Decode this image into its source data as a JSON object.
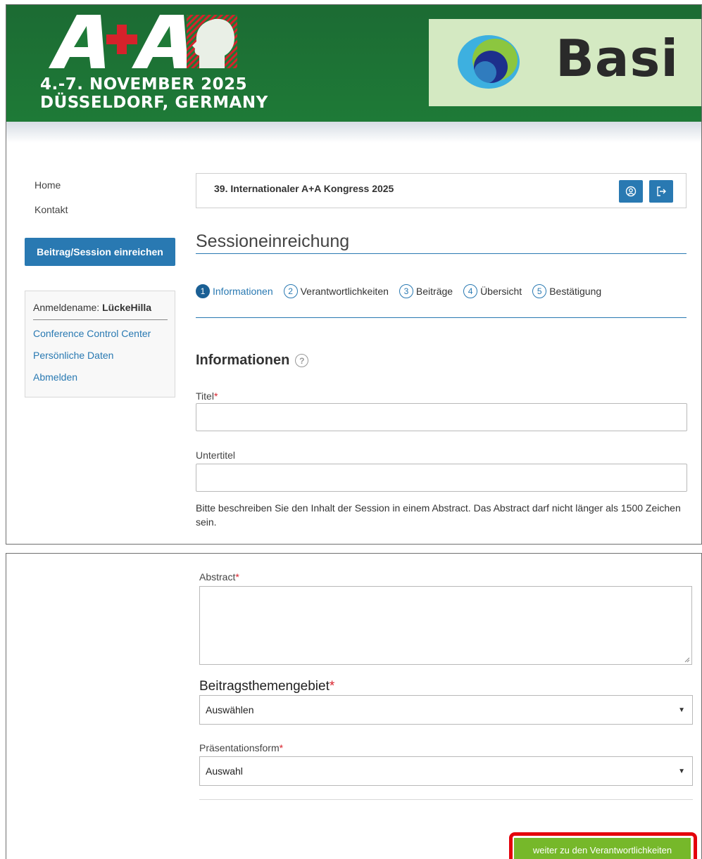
{
  "banner": {
    "aa_logo_text": "A+A",
    "date_line": "4.-7. NOVEMBER 2025",
    "location_line": "DÜSSELDORF, GERMANY",
    "sponsor_text": "Basi",
    "colors": {
      "banner_green": "#1e7a37",
      "sponsor_bg": "#d4e9c2"
    }
  },
  "sidebar": {
    "nav": [
      {
        "label": "Home"
      },
      {
        "label": "Kontakt"
      }
    ],
    "submit_button": "Beitrag/Session einreichen",
    "login": {
      "name_label": "Anmeldename:",
      "username": "LückeHilla",
      "links": [
        "Conference Control Center",
        "Persönliche Daten",
        "Abmelden"
      ]
    }
  },
  "main": {
    "conference_title": "39. Internationaler A+A Kongress 2025",
    "icons": {
      "profile": "profile-icon",
      "logout": "logout-icon"
    },
    "page_title": "Sessioneinreichung",
    "steps": [
      {
        "num": "1",
        "label": "Informationen"
      },
      {
        "num": "2",
        "label": "Verantwortlichkeiten"
      },
      {
        "num": "3",
        "label": "Beiträge"
      },
      {
        "num": "4",
        "label": "Übersicht"
      },
      {
        "num": "5",
        "label": "Bestätigung"
      }
    ],
    "section_title": "Informationen",
    "help_glyph": "?",
    "required_mark": "*",
    "fields": {
      "title_label": "Titel",
      "title_value": "",
      "subtitle_label": "Untertitel",
      "subtitle_value": "",
      "hint": "Bitte beschreiben Sie den Inhalt der Session in einem Abstract. Das Abstract darf nicht länger als 1500 Zeichen sein.",
      "abstract_label": "Abstract",
      "abstract_value": "",
      "topic_label": "Beitragsthemengebiet",
      "topic_selected": "Auswählen",
      "format_label": "Präsentationsform",
      "format_selected": "Auswahl"
    },
    "next_button": "weiter zu den Verantwortlichkeiten",
    "colors": {
      "primary": "#2979b2",
      "next_green": "#76b82a",
      "highlight": "#e4000b",
      "required": "#d9232d"
    }
  }
}
